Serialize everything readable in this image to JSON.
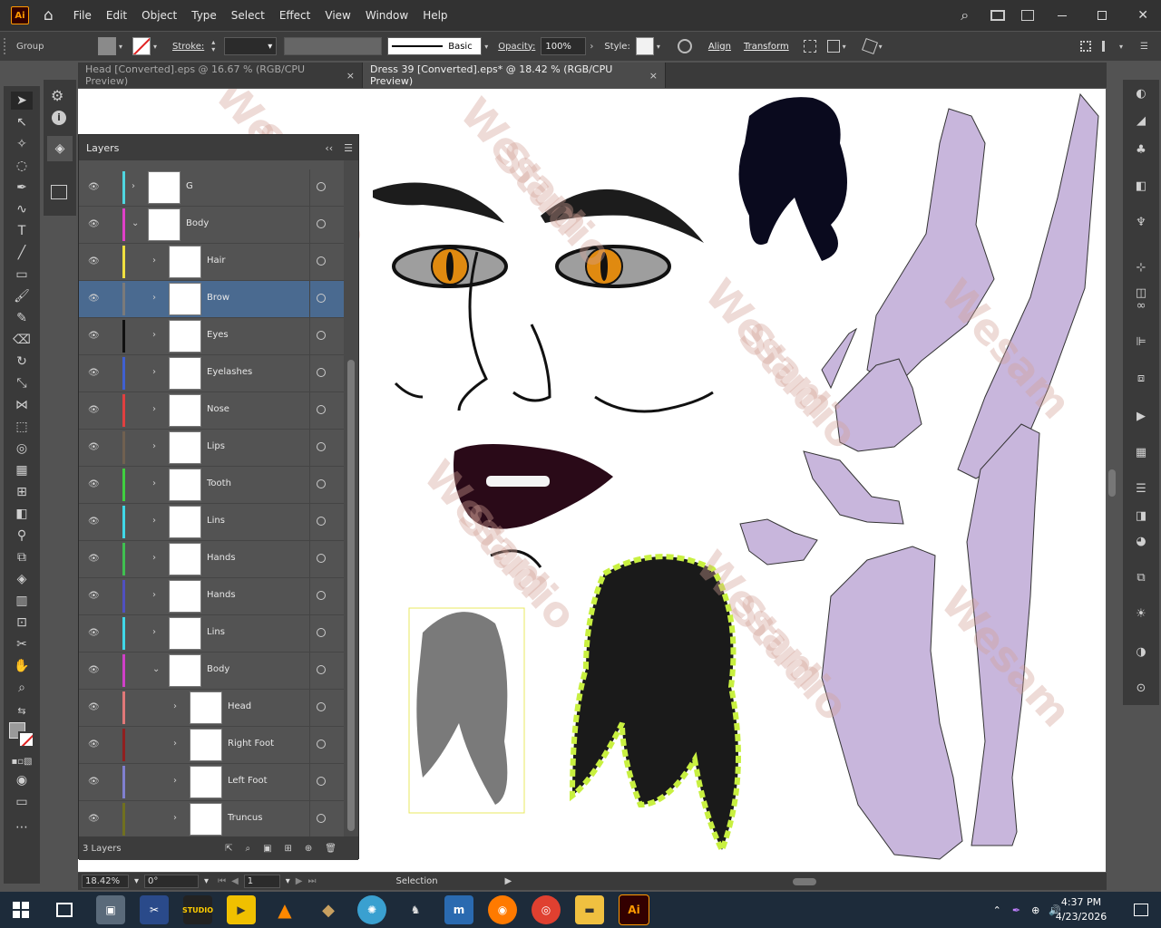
{
  "app": {
    "logo": "Ai",
    "menu": [
      "File",
      "Edit",
      "Object",
      "Type",
      "Select",
      "Effect",
      "View",
      "Window",
      "Help"
    ]
  },
  "control_bar": {
    "group_label": "Group",
    "stroke_label": "Stroke:",
    "brush_label": "Basic",
    "opacity_label": "Opacity:",
    "opacity_value": "100%",
    "style_label": "Style:",
    "align_label": "Align",
    "transform_label": "Transform"
  },
  "tabs": [
    {
      "label": "Head [Converted].eps @ 16.67 % (RGB/CPU Preview)",
      "close": "×"
    },
    {
      "label": "Dress 39 [Converted].eps* @ 18.42 % (RGB/CPU Preview)",
      "close": "×"
    }
  ],
  "layers_panel": {
    "title": "Layers",
    "collapse": "‹‹",
    "menu": "☰",
    "footer_count": "3 Layers",
    "rows": [
      {
        "name": "G",
        "color": "#4fd6e0",
        "indent": 0,
        "expanded": false
      },
      {
        "name": "Body",
        "color": "#e040c8",
        "indent": 0,
        "expanded": true
      },
      {
        "name": "Hair",
        "color": "#f0e040",
        "indent": 1,
        "expanded": false
      },
      {
        "name": "Brow",
        "color": "#7a7a7a",
        "indent": 1,
        "expanded": false,
        "selected": true
      },
      {
        "name": "Eyes",
        "color": "#111111",
        "indent": 1,
        "expanded": false
      },
      {
        "name": "Eyelashes",
        "color": "#4060d0",
        "indent": 1,
        "expanded": false
      },
      {
        "name": "Nose",
        "color": "#e04040",
        "indent": 1,
        "expanded": false
      },
      {
        "name": "Lips",
        "color": "#706050",
        "indent": 1,
        "expanded": false
      },
      {
        "name": "Tooth",
        "color": "#40d040",
        "indent": 1,
        "expanded": false
      },
      {
        "name": "Lins",
        "color": "#40d8e8",
        "indent": 1,
        "expanded": false
      },
      {
        "name": "Hands",
        "color": "#40c050",
        "indent": 1,
        "expanded": false
      },
      {
        "name": "Hands",
        "color": "#5050c0",
        "indent": 1,
        "expanded": false
      },
      {
        "name": "Lins",
        "color": "#40d8e8",
        "indent": 1,
        "expanded": false
      },
      {
        "name": "Body",
        "color": "#d040c8",
        "indent": 1,
        "expanded": true
      },
      {
        "name": "Head",
        "color": "#e07878",
        "indent": 2,
        "expanded": false
      },
      {
        "name": "Right Foot",
        "color": "#902020",
        "indent": 2,
        "expanded": false
      },
      {
        "name": "Left Foot",
        "color": "#8080d0",
        "indent": 2,
        "expanded": false
      },
      {
        "name": "Truncus",
        "color": "#707020",
        "indent": 2,
        "expanded": false
      }
    ]
  },
  "status_bar": {
    "zoom": "18.42%",
    "rotation": "0°",
    "artboard": "1",
    "tool": "Selection"
  },
  "taskbar": {
    "time": "4:37 PM",
    "date": "4/23/2026"
  },
  "watermark_lines": [
    "Wesam",
    "Studio"
  ]
}
